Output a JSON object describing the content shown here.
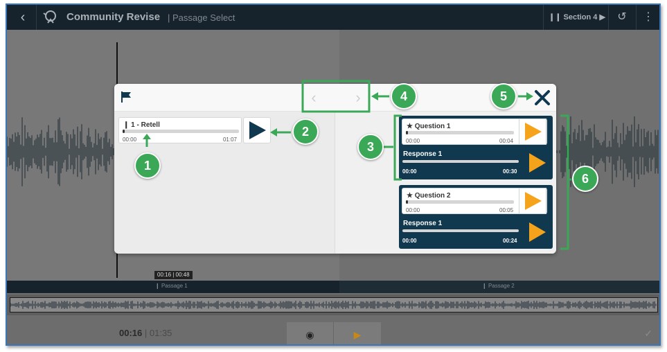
{
  "topbar": {
    "app_title": "Community Revise",
    "subtitle": "Passage Select",
    "section_label": "Section 4"
  },
  "player": {
    "current_time": "00:16",
    "total_time": "01:35",
    "marker_time": "00:16 | 00:48"
  },
  "passages": [
    "Passage 1",
    "Passage 2"
  ],
  "modal": {
    "passage_item": {
      "label": "1 - Retell",
      "start": "00:00",
      "end": "01:07"
    },
    "questions": [
      {
        "question_label": "Question 1",
        "question_start": "00:00",
        "question_end": "00:04",
        "response_label": "Response 1",
        "response_start": "00:00",
        "response_end": "00:30"
      },
      {
        "question_label": "Question 2",
        "question_start": "00:00",
        "question_end": "00:05",
        "response_label": "Response 1",
        "response_start": "00:00",
        "response_end": "00:24"
      }
    ]
  },
  "annotations": [
    "1",
    "2",
    "3",
    "4",
    "5",
    "6"
  ],
  "colors": {
    "accent_green": "#3aa857",
    "play_orange": "#f5a31a",
    "dark_navy": "#10384f",
    "topbar": "#17232c"
  }
}
